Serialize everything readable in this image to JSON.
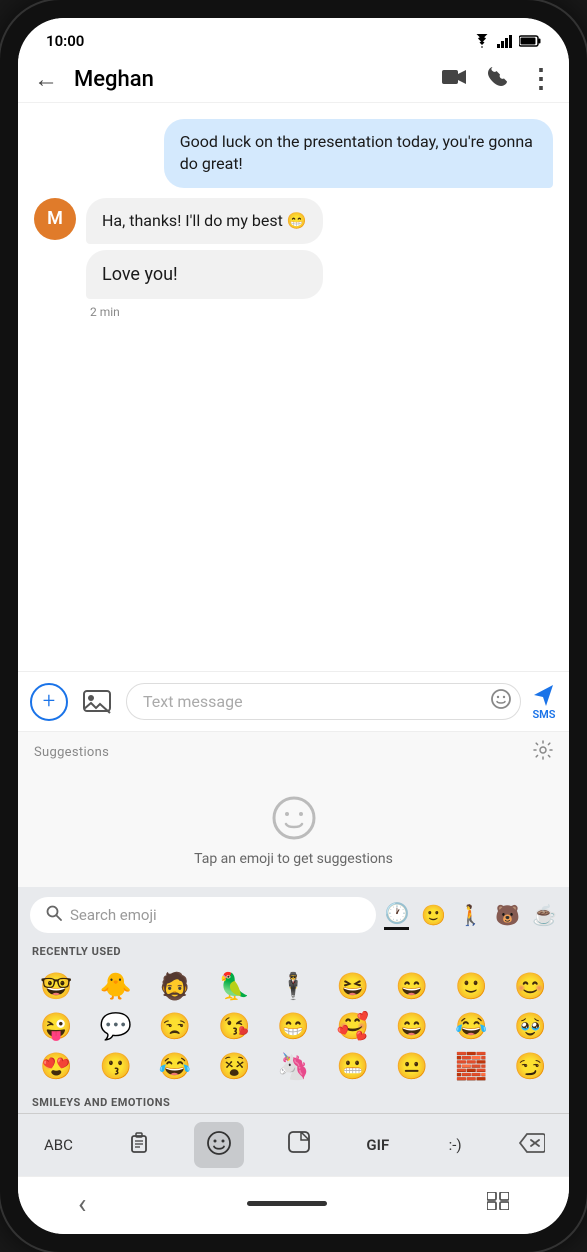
{
  "status": {
    "time": "10:00",
    "wifi": "▲",
    "signal": "▲",
    "battery": "▮"
  },
  "appBar": {
    "backLabel": "←",
    "title": "Meghan",
    "videoIcon": "📹",
    "phoneIcon": "📞",
    "moreIcon": "⋮"
  },
  "messages": [
    {
      "type": "sent",
      "text": "Good luck on the presentation today, you're gonna do great!"
    },
    {
      "type": "received",
      "avatarLabel": "M",
      "bubbles": [
        {
          "text": "Ha, thanks! I'll do my best 😁"
        },
        {
          "text": "Love you!"
        }
      ],
      "time": "2 min"
    }
  ],
  "inputBar": {
    "addIconLabel": "+",
    "imageIconLabel": "🖼",
    "placeholder": "Text message",
    "emojiIconLabel": "☺",
    "sendLabel": "SMS"
  },
  "suggestions": {
    "label": "Suggestions",
    "tapText": "Tap an emoji to get suggestions"
  },
  "emojiSearch": {
    "placeholder": "Search emoji"
  },
  "categories": {
    "recentLabel": "RECENTLY USED",
    "smileysLabel": "SMILEYS AND EMOTIONS"
  },
  "recentEmojis": [
    "🤓",
    "🐥",
    "🧔",
    "🦜",
    "🕴",
    "😆",
    "😄",
    "🙂",
    "😊",
    "😜",
    "💬",
    "😒",
    "😘",
    "😁",
    "🥰",
    "😄",
    "😂",
    "🥹",
    "😍",
    "😗",
    "😂",
    "😵",
    "🦄",
    "😬",
    "😐",
    "🧱",
    "😏"
  ],
  "bottomBar": {
    "abc": "ABC",
    "clipIcon": "📋",
    "emojiActive": "☺",
    "stickerIcon": "🗨",
    "gif": "GIF",
    "emoticon": ":-)",
    "deleteIcon": "⌫"
  },
  "navBar": {
    "backIcon": "‹",
    "homeBar": "",
    "appSwitcherIcon": "⊞"
  }
}
